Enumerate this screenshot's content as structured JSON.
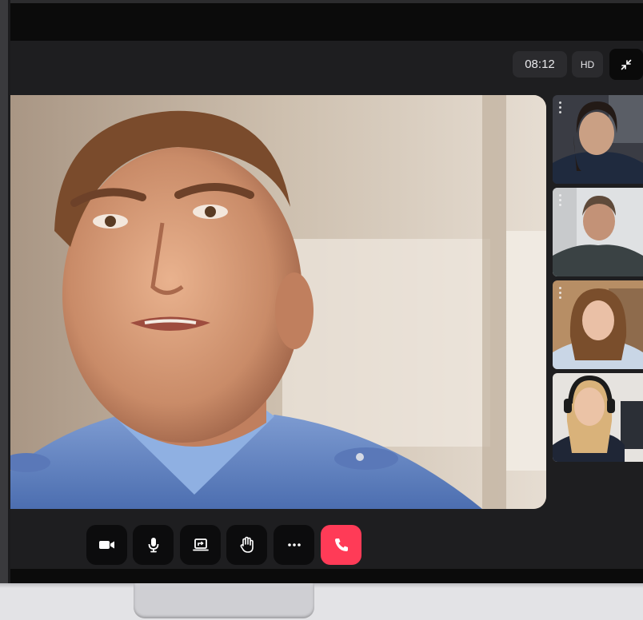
{
  "call": {
    "timer": "08:12",
    "quality": "HD",
    "collapse_icon": "collapse-icon"
  },
  "main_participant": {
    "icon": "participant-video"
  },
  "participants": [
    {
      "icon": "participant-thumbnail-1"
    },
    {
      "icon": "participant-thumbnail-2"
    },
    {
      "icon": "participant-thumbnail-3"
    },
    {
      "icon": "participant-thumbnail-4"
    }
  ],
  "controls": [
    {
      "name": "camera",
      "icon": "video-camera-icon"
    },
    {
      "name": "microphone",
      "icon": "microphone-icon"
    },
    {
      "name": "share-screen",
      "icon": "screen-share-icon"
    },
    {
      "name": "raise-hand",
      "icon": "hand-icon"
    },
    {
      "name": "more",
      "icon": "more-options-icon"
    },
    {
      "name": "end-call",
      "icon": "phone-hangup-icon"
    }
  ],
  "colors": {
    "app_background": "#1e1e20",
    "control_background": "#0c0c0d",
    "end_call": "#ff3b57",
    "pill_background": "#2b2b2e"
  }
}
